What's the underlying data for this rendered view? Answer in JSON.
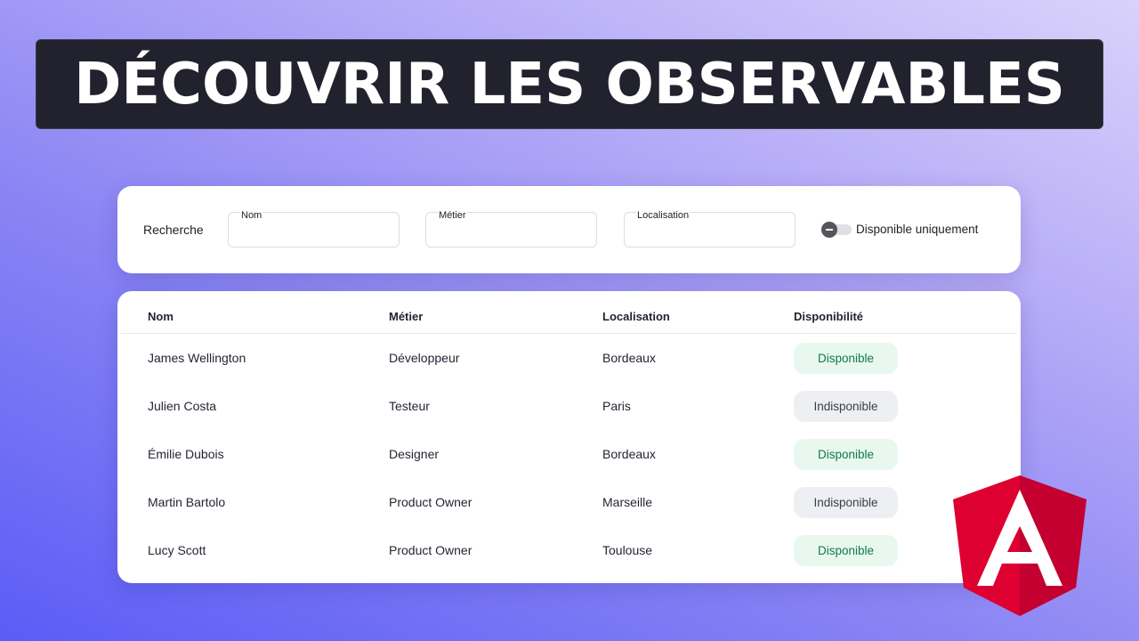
{
  "title": "DÉCOUVRIR LES OBSERVABLES",
  "search": {
    "label": "Recherche",
    "fields": [
      {
        "label": "Nom",
        "value": ""
      },
      {
        "label": "Métier",
        "value": ""
      },
      {
        "label": "Localisation",
        "value": ""
      }
    ],
    "toggle_label": "Disponible uniquement",
    "toggle_on": false
  },
  "table": {
    "headers": [
      "Nom",
      "Métier",
      "Localisation",
      "Disponibilité"
    ],
    "rows": [
      {
        "nom": "James Wellington",
        "metier": "Développeur",
        "localisation": "Bordeaux",
        "dispo": "Disponible",
        "available": true
      },
      {
        "nom": "Julien Costa",
        "metier": "Testeur",
        "localisation": "Paris",
        "dispo": "Indisponible",
        "available": false
      },
      {
        "nom": "Émilie Dubois",
        "metier": "Designer",
        "localisation": "Bordeaux",
        "dispo": "Disponible",
        "available": true
      },
      {
        "nom": "Martin Bartolo",
        "metier": "Product Owner",
        "localisation": "Marseille",
        "dispo": "Indisponible",
        "available": false
      },
      {
        "nom": "Lucy Scott",
        "metier": "Product Owner",
        "localisation": "Toulouse",
        "dispo": "Disponible",
        "available": true
      }
    ]
  },
  "logo": {
    "name": "angular-logo-icon",
    "letter": "A",
    "color": "#dd0031",
    "dark_color": "#c3002f"
  },
  "colors": {
    "available_bg": "#e8f8ee",
    "available_text": "#137a46",
    "unavailable_bg": "#eeeff3"
  }
}
